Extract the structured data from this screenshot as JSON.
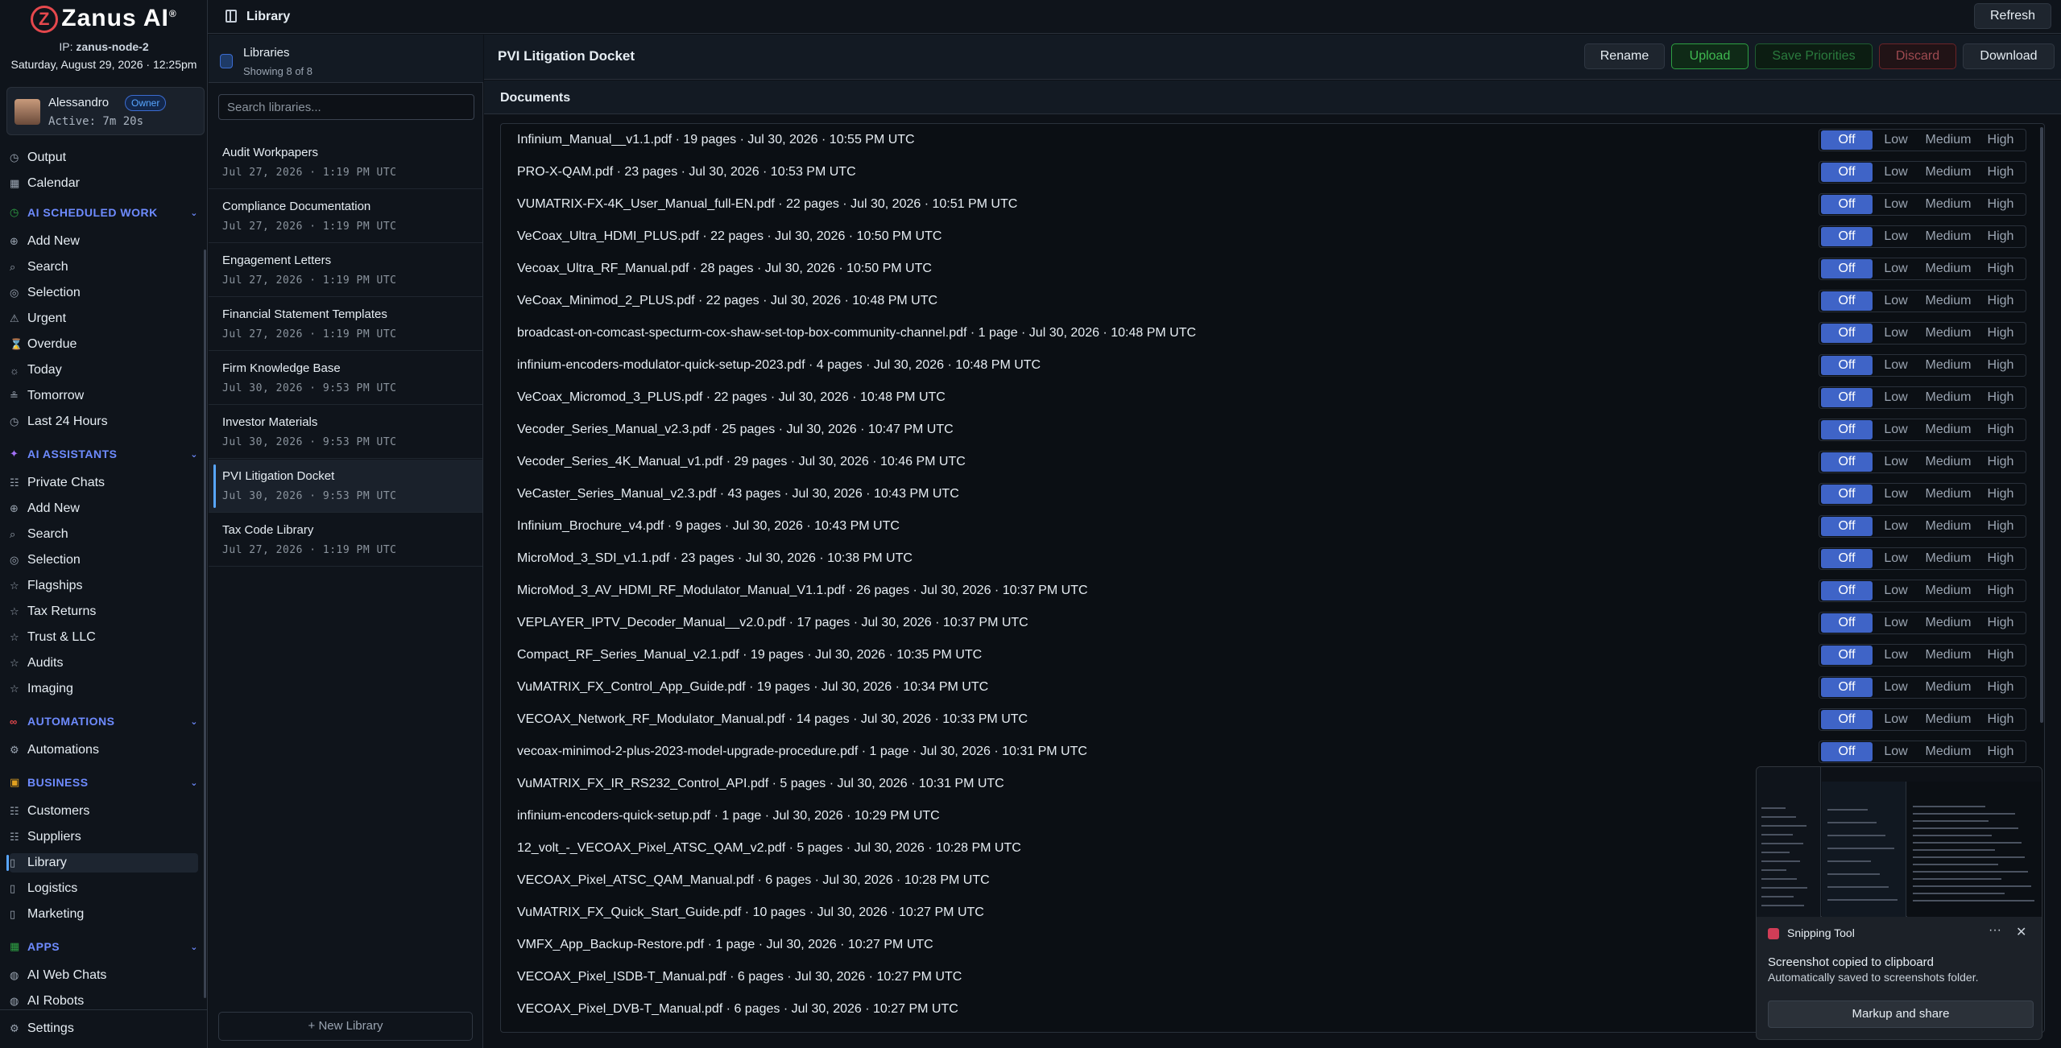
{
  "app": {
    "brand": "Zanus AI",
    "brand_mark": "®",
    "ip_label": "IP:",
    "ip": "zanus-node-2",
    "datetime": "Saturday, August 29, 2026 · 12:25pm"
  },
  "user": {
    "name": "Alessandro",
    "role": "Owner",
    "active": "Active: 7m 20s"
  },
  "nav": {
    "top": [
      {
        "label": "Output",
        "icon": "output-icon"
      },
      {
        "label": "Calendar",
        "icon": "calendar-icon"
      }
    ],
    "sections": [
      {
        "title": "AI SCHEDULED WORK",
        "items": [
          "Add New",
          "Search",
          "Selection",
          "Urgent",
          "Overdue",
          "Today",
          "Tomorrow",
          "Last 24 Hours"
        ]
      },
      {
        "title": "AI ASSISTANTS",
        "items": [
          "Private Chats",
          "Add New",
          "Search",
          "Selection",
          "Flagships",
          "Tax Returns",
          "Trust & LLC",
          "Audits",
          "Imaging"
        ]
      },
      {
        "title": "AUTOMATIONS",
        "items": [
          "Automations"
        ]
      },
      {
        "title": "BUSINESS",
        "items": [
          "Customers",
          "Suppliers",
          "Library",
          "Logistics",
          "Marketing"
        ]
      },
      {
        "title": "APPS",
        "items": [
          "AI Web Chats",
          "AI Robots"
        ]
      }
    ],
    "settings": "Settings"
  },
  "topbar": {
    "title": "Library",
    "refresh": "Refresh"
  },
  "libraries": {
    "title": "Libraries",
    "subtitle": "Showing 8 of 8",
    "search_placeholder": "Search libraries...",
    "items": [
      {
        "name": "Audit Workpapers",
        "date": "Jul 27, 2026 · 1:19 PM UTC"
      },
      {
        "name": "Compliance Documentation",
        "date": "Jul 27, 2026 · 1:19 PM UTC"
      },
      {
        "name": "Engagement Letters",
        "date": "Jul 27, 2026 · 1:19 PM UTC"
      },
      {
        "name": "Financial Statement Templates",
        "date": "Jul 27, 2026 · 1:19 PM UTC"
      },
      {
        "name": "Firm Knowledge Base",
        "date": "Jul 30, 2026 · 9:53 PM UTC"
      },
      {
        "name": "Investor Materials",
        "date": "Jul 30, 2026 · 9:53 PM UTC"
      },
      {
        "name": "PVI Litigation Docket",
        "date": "Jul 30, 2026 · 9:53 PM UTC"
      },
      {
        "name": "Tax Code Library",
        "date": "Jul 27, 2026 · 1:19 PM UTC"
      }
    ],
    "selected_index": 6,
    "new_library": "+ New Library"
  },
  "main": {
    "title": "PVI Litigation Docket",
    "buttons": {
      "rename": "Rename",
      "upload": "Upload",
      "save": "Save Priorities",
      "discard": "Discard",
      "download": "Download"
    },
    "documents_label": "Documents",
    "priority_options": [
      "Off",
      "Low",
      "Medium",
      "High"
    ],
    "selected_priority": "Off",
    "documents": [
      "Infinium_Manual__v1.1.pdf · 19 pages · Jul 30, 2026 · 10:55 PM UTC",
      "PRO-X-QAM.pdf · 23 pages · Jul 30, 2026 · 10:53 PM UTC",
      "VUMATRIX-FX-4K_User_Manual_full-EN.pdf · 22 pages · Jul 30, 2026 · 10:51 PM UTC",
      "VeCoax_Ultra_HDMI_PLUS.pdf · 22 pages · Jul 30, 2026 · 10:50 PM UTC",
      "Vecoax_Ultra_RF_Manual.pdf · 28 pages · Jul 30, 2026 · 10:50 PM UTC",
      "VeCoax_Minimod_2_PLUS.pdf · 22 pages · Jul 30, 2026 · 10:48 PM UTC",
      "broadcast-on-comcast-specturm-cox-shaw-set-top-box-community-channel.pdf · 1 page · Jul 30, 2026 · 10:48 PM UTC",
      "infinium-encoders-modulator-quick-setup-2023.pdf · 4 pages · Jul 30, 2026 · 10:48 PM UTC",
      "VeCoax_Micromod_3_PLUS.pdf · 22 pages · Jul 30, 2026 · 10:48 PM UTC",
      "Vecoder_Series_Manual_v2.3.pdf · 25 pages · Jul 30, 2026 · 10:47 PM UTC",
      "Vecoder_Series_4K_Manual_v1.pdf · 29 pages · Jul 30, 2026 · 10:46 PM UTC",
      "VeCaster_Series_Manual_v2.3.pdf · 43 pages · Jul 30, 2026 · 10:43 PM UTC",
      "Infinium_Brochure_v4.pdf · 9 pages · Jul 30, 2026 · 10:43 PM UTC",
      "MicroMod_3_SDI_v1.1.pdf · 23 pages · Jul 30, 2026 · 10:38 PM UTC",
      "MicroMod_3_AV_HDMI_RF_Modulator_Manual_V1.1.pdf · 26 pages · Jul 30, 2026 · 10:37 PM UTC",
      "VEPLAYER_IPTV_Decoder_Manual__v2.0.pdf · 17 pages · Jul 30, 2026 · 10:37 PM UTC",
      "Compact_RF_Series_Manual_v2.1.pdf · 19 pages · Jul 30, 2026 · 10:35 PM UTC",
      "VuMATRIX_FX_Control_App_Guide.pdf · 19 pages · Jul 30, 2026 · 10:34 PM UTC",
      "VECOAX_Network_RF_Modulator_Manual.pdf · 14 pages · Jul 30, 2026 · 10:33 PM UTC",
      "vecoax-minimod-2-plus-2023-model-upgrade-procedure.pdf · 1 page · Jul 30, 2026 · 10:31 PM UTC",
      "VuMATRIX_FX_IR_RS232_Control_API.pdf · 5 pages · Jul 30, 2026 · 10:31 PM UTC",
      "infinium-encoders-quick-setup.pdf · 1 page · Jul 30, 2026 · 10:29 PM UTC",
      "12_volt_-_VECOAX_Pixel_ATSC_QAM_v2.pdf · 5 pages · Jul 30, 2026 · 10:28 PM UTC",
      "VECOAX_Pixel_ATSC_QAM_Manual.pdf · 6 pages · Jul 30, 2026 · 10:28 PM UTC",
      "VuMATRIX_FX_Quick_Start_Guide.pdf · 10 pages · Jul 30, 2026 · 10:27 PM UTC",
      "VMFX_App_Backup-Restore.pdf · 1 page · Jul 30, 2026 · 10:27 PM UTC",
      "VECOAX_Pixel_ISDB-T_Manual.pdf · 6 pages · Jul 30, 2026 · 10:27 PM UTC",
      "VECOAX_Pixel_DVB-T_Manual.pdf · 6 pages · Jul 30, 2026 · 10:27 PM UTC"
    ]
  },
  "toast": {
    "app": "Snipping Tool",
    "more": "···",
    "close": "✕",
    "title": "Screenshot copied to clipboard",
    "message": "Automatically saved to screenshots folder.",
    "action": "Markup and share"
  },
  "colors": {
    "accent": "#3f64c7",
    "section": "#6e8bff",
    "upload": "#3fb950",
    "discard": "#9e4a50"
  }
}
